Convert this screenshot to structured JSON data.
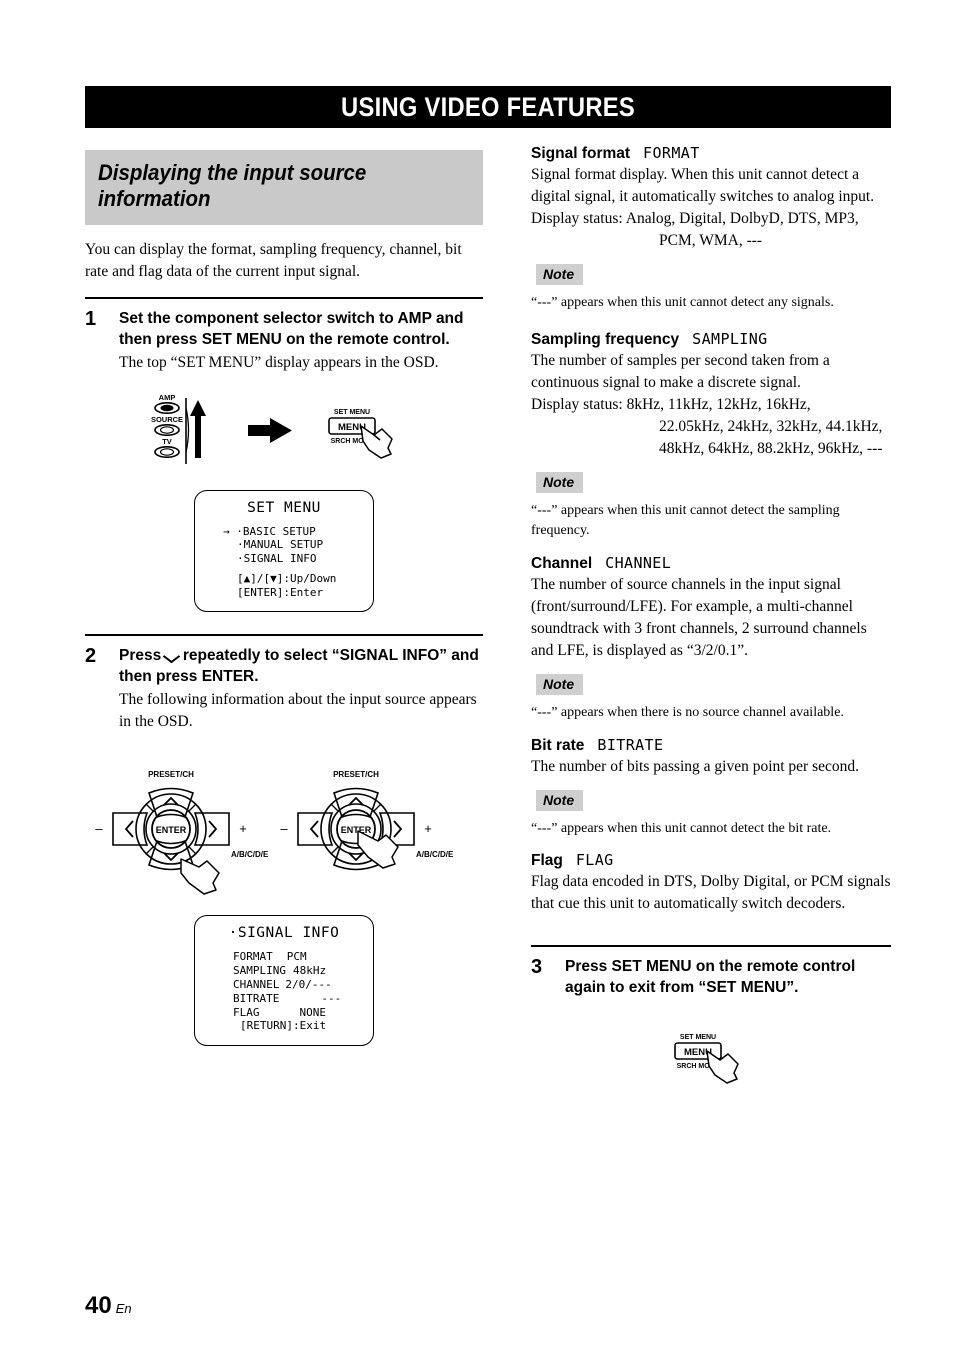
{
  "banner": {
    "title": "USING VIDEO FEATURES"
  },
  "section": {
    "heading": "Displaying the input source information",
    "intro": "You can display the format, sampling frequency, channel, bit rate and flag data of the current input signal."
  },
  "steps": [
    {
      "number": "1",
      "title": "Set the component selector switch to AMP and then press SET MENU on the remote control.",
      "desc": "The top “SET MENU” display appears in the OSD."
    },
    {
      "number": "2",
      "title_before": "Press",
      "title_after": "repeatedly to select “SIGNAL INFO” and then press ENTER.",
      "desc": "The following information about the input source appears in the OSD."
    },
    {
      "number": "3",
      "title": "Press SET MENU on the remote control again to exit from “SET MENU”."
    }
  ],
  "figures": {
    "selector_switch": {
      "labels": [
        "AMP",
        "SOURCE",
        "TV"
      ]
    },
    "menu_button": {
      "top_label": "SET MENU",
      "button_label": "MENU",
      "bottom_label": "SRCH MODE"
    },
    "nav_pad": {
      "top_label": "PRESET/CH",
      "center_label": "ENTER",
      "left_sign": "–",
      "right_sign": "+",
      "corner_label": "A/B/C/D/E"
    }
  },
  "osd_set_menu": {
    "title": "SET MENU",
    "cursor": "→",
    "items": [
      "·BASIC SETUP",
      "·MANUAL SETUP",
      "·SIGNAL INFO"
    ],
    "hints": [
      "[▲]/[▼]:Up/Down",
      "[ENTER]:Enter"
    ]
  },
  "osd_signal_info": {
    "title": "·SIGNAL INFO",
    "rows": [
      {
        "label": "FORMAT",
        "value": "PCM"
      },
      {
        "label": "SAMPLING",
        "value": "48kHz"
      },
      {
        "label": "CHANNEL",
        "value": "2/0/---"
      },
      {
        "label": "BITRATE",
        "value": "---"
      },
      {
        "label": "FLAG",
        "value": "NONE"
      }
    ],
    "exit_hint": "[RETURN]:Exit"
  },
  "terms": [
    {
      "name": "Signal format",
      "code": "FORMAT",
      "desc": "Signal format display. When this unit cannot detect a digital signal, it automatically switches to analog input.",
      "display_status_label": "Display status:",
      "display_status_line1": "Analog, Digital, DolbyD, DTS, MP3,",
      "display_status_line2": "PCM, WMA, ---",
      "note_label": "Note",
      "note": "“---” appears when this unit cannot detect any signals."
    },
    {
      "name": "Sampling frequency",
      "code": "SAMPLING",
      "desc": "The number of samples per second taken from a continuous signal to make a discrete signal.",
      "display_status_label": "Display status:",
      "display_status_line1": "8kHz, 11kHz, 12kHz, 16kHz,",
      "display_status_line2": "22.05kHz, 24kHz, 32kHz, 44.1kHz,",
      "display_status_line3": "48kHz, 64kHz, 88.2kHz, 96kHz, ---",
      "note_label": "Note",
      "note": "“---” appears when this unit cannot detect the sampling frequency."
    },
    {
      "name": "Channel",
      "code": "CHANNEL",
      "desc": "The number of source channels in the input signal (front/surround/LFE). For example, a multi-channel soundtrack with 3 front channels, 2 surround channels and LFE, is displayed as “3/2/0.1”.",
      "note_label": "Note",
      "note": "“---” appears when there is no source channel available."
    },
    {
      "name": "Bit rate",
      "code": "BITRATE",
      "desc": "The number of bits passing a given point per second.",
      "note_label": "Note",
      "note": "“---” appears when this unit cannot detect the bit rate."
    },
    {
      "name": "Flag",
      "code": "FLAG",
      "desc": "Flag data encoded in DTS, Dolby Digital, or PCM signals that cue this unit to automatically switch decoders."
    }
  ],
  "footer": {
    "page": "40",
    "lang": "En"
  }
}
